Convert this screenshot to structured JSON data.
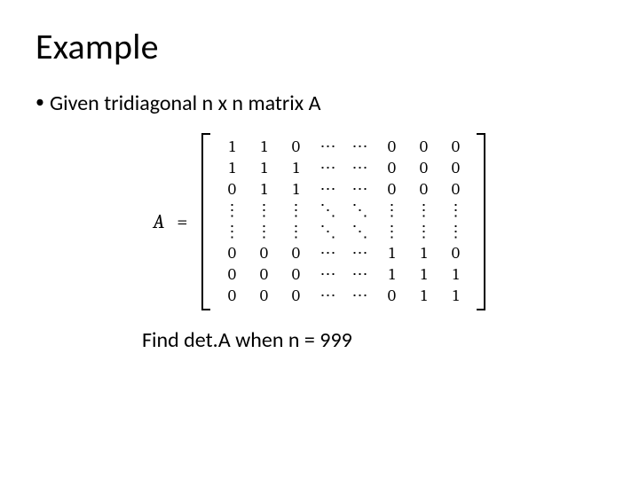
{
  "title": "Example",
  "bullet": {
    "dot": "•",
    "text": "Given tridiagonal n x n matrix A"
  },
  "matrix": {
    "lhs": "A",
    "eq": "=",
    "rows": [
      [
        "1",
        "1",
        "0",
        "⋯",
        "⋯",
        "0",
        "0",
        "0"
      ],
      [
        "1",
        "1",
        "1",
        "⋯",
        "⋯",
        "0",
        "0",
        "0"
      ],
      [
        "0",
        "1",
        "1",
        "⋯",
        "⋯",
        "0",
        "0",
        "0"
      ],
      [
        "⋮",
        "⋮",
        "⋮",
        "⋱",
        "⋱",
        "⋮",
        "⋮",
        "⋮"
      ],
      [
        "⋮",
        "⋮",
        "⋮",
        "⋱",
        "⋱",
        "⋮",
        "⋮",
        "⋮"
      ],
      [
        "0",
        "0",
        "0",
        "⋯",
        "⋯",
        "1",
        "1",
        "0"
      ],
      [
        "0",
        "0",
        "0",
        "⋯",
        "⋯",
        "1",
        "1",
        "1"
      ],
      [
        "0",
        "0",
        "0",
        "⋯",
        "⋯",
        "0",
        "1",
        "1"
      ]
    ]
  },
  "question": "Find det.A when n = 999"
}
